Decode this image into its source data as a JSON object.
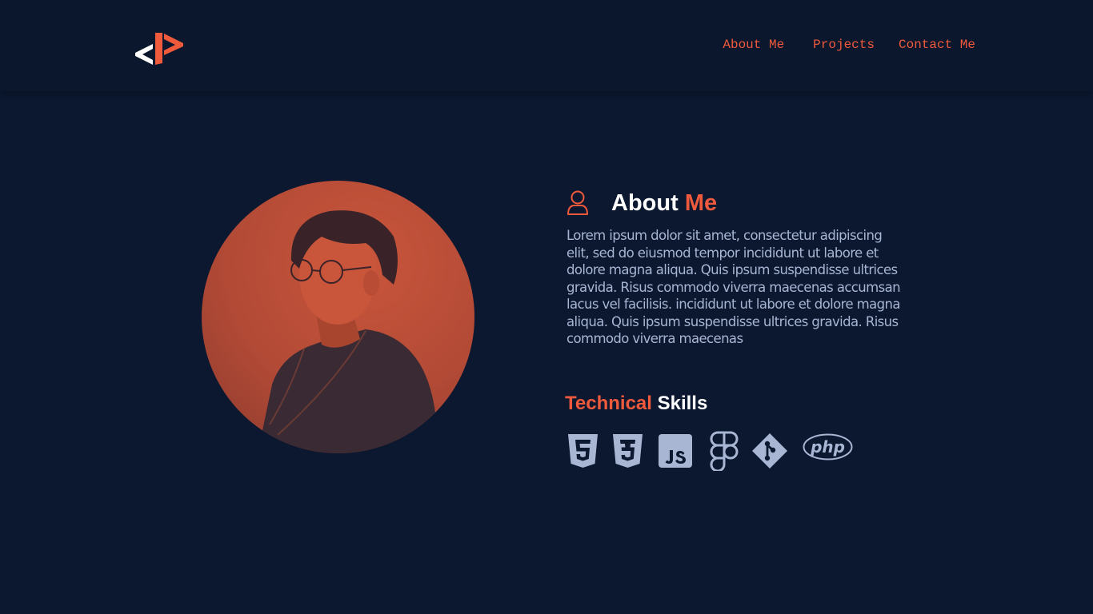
{
  "header": {
    "logo_icon": "code-bracket-logo-icon",
    "nav": [
      {
        "label": "About Me"
      },
      {
        "label": "Projects"
      },
      {
        "label": "Contact Me"
      }
    ]
  },
  "about": {
    "icon": "user-icon",
    "title_white": "About ",
    "title_accent": "Me",
    "bio": "Lorem ipsum dolor sit amet, consectetur adipiscing elit, sed do eiusmod tempor incididunt ut labore et dolore magna aliqua. Quis ipsum suspendisse ultrices gravida. Risus commodo viverra maecenas accumsan lacus vel facilisis. incididunt ut labore et dolore magna aliqua. Quis ipsum suspendisse ultrices gravida. Risus commodo viverra maecenas"
  },
  "skills": {
    "title_accent": "Technical",
    "title_white": " Skills",
    "icons": [
      "html5-icon",
      "css3-icon",
      "javascript-icon",
      "figma-icon",
      "git-icon",
      "php-icon"
    ],
    "php_label": "php"
  },
  "colors": {
    "background": "#0b1830",
    "accent": "#f05a3c",
    "text_muted": "#a8b6d3",
    "icon_color": "#a8b6d3"
  }
}
